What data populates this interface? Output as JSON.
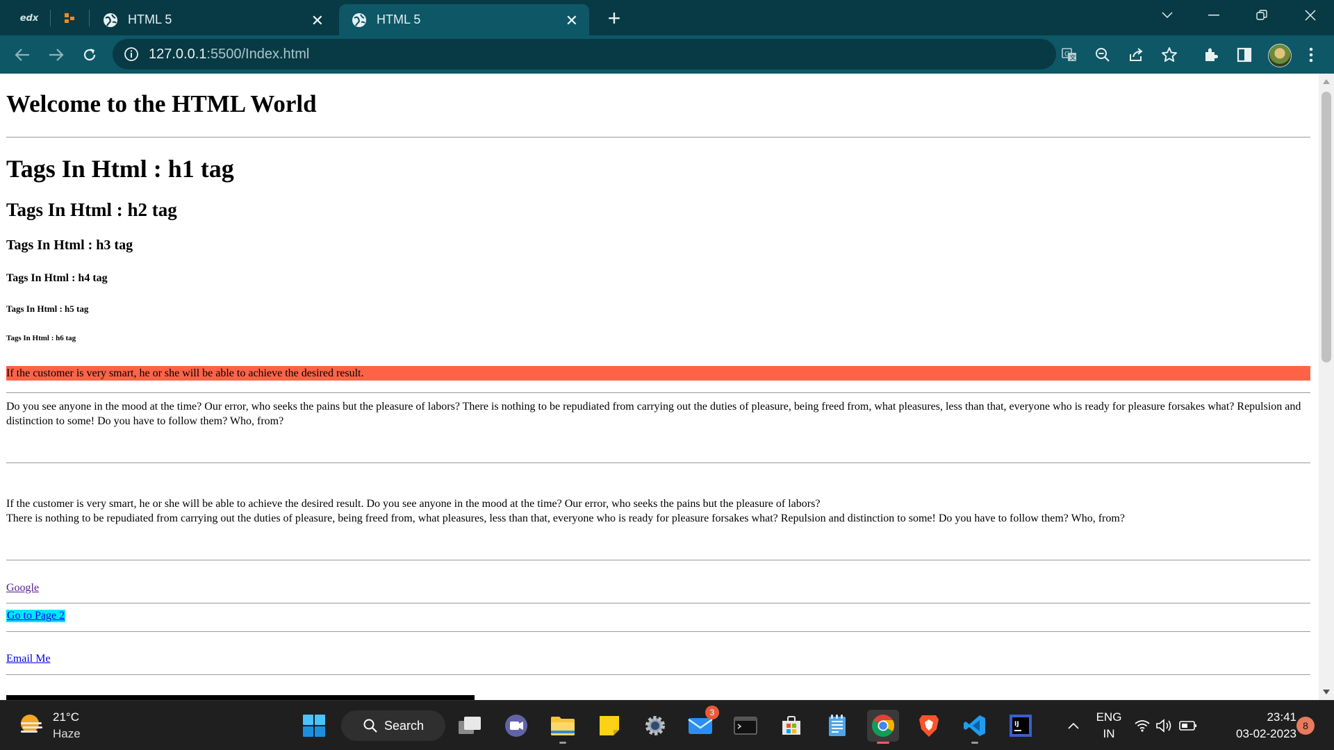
{
  "browser": {
    "pinned_tabs": [
      {
        "label": "edx",
        "icon": "edx-icon"
      },
      {
        "icon": "app-icon"
      }
    ],
    "tabs": [
      {
        "title": "HTML 5",
        "icon": "globe-icon",
        "active": false
      },
      {
        "title": "HTML 5",
        "icon": "globe-icon",
        "active": true
      }
    ],
    "url_host": "127.0.0.1",
    "url_path": ":5500/Index.html",
    "accent_color": "#0e5766",
    "frame_color": "#083a45"
  },
  "page": {
    "welcome": "Welcome to the HTML World",
    "h1": "Tags In Html : h1 tag",
    "h2": "Tags In Html : h2 tag",
    "h3": "Tags In Html : h3 tag",
    "h4": "Tags In Html : h4 tag",
    "h5": "Tags In Html : h5 tag",
    "h6": "Tags In Html : h6 tag",
    "highlight": "If the customer is very smart, he or she will be able to achieve the desired result.",
    "highlight_color": "#ff6347",
    "paragraph1": "Do you see anyone in the mood at the time? Our error, who seeks the pains but the pleasure of labors? There is nothing to be repudiated from carrying out the duties of pleasure, being freed from, what pleasures, less than that, everyone who is ready for pleasure forsakes what? Repulsion and distinction to some! Do you have to follow them? Who, from?",
    "paragraph2_line1": "If the customer is very smart, he or she will be able to achieve the desired result. Do you see anyone in the mood at the time? Our error, who seeks the pains but the pleasure of labors?",
    "paragraph2_line2": "There is nothing to be repudiated from carrying out the duties of pleasure, being freed from, what pleasures, less than that, everyone who is ready for pleasure forsakes what? Repulsion and distinction to some! Do you have to follow them? Who, from?",
    "link_google": "Google",
    "link_page2": "Go to Page 2",
    "link_email": "Email Me",
    "link_page2_bg": "#00e5ff"
  },
  "taskbar": {
    "weather_temp": "21°C",
    "weather_desc": "Haze",
    "search_label": "Search",
    "mail_badge": "3",
    "lang_top": "ENG",
    "lang_bottom": "IN",
    "time": "23:41",
    "date": "03-02-2023",
    "notification_count": "8"
  }
}
